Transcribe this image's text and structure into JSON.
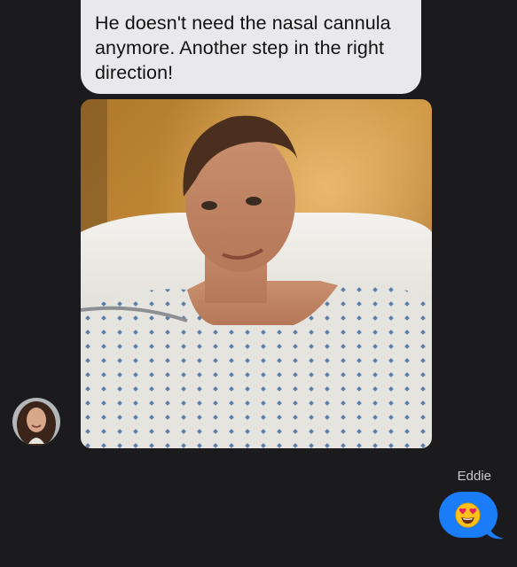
{
  "thread": {
    "incoming_message": "He doesn't need the nasal cannula anymore. Another step in the right direction!",
    "outgoing_sender": "Eddie",
    "outgoing_reaction": "smiling-face-with-heart-eyes"
  },
  "colors": {
    "background": "#1b1b1d",
    "incoming_bubble": "#e9e9eb",
    "outgoing_bubble": "#1a7cf6"
  }
}
